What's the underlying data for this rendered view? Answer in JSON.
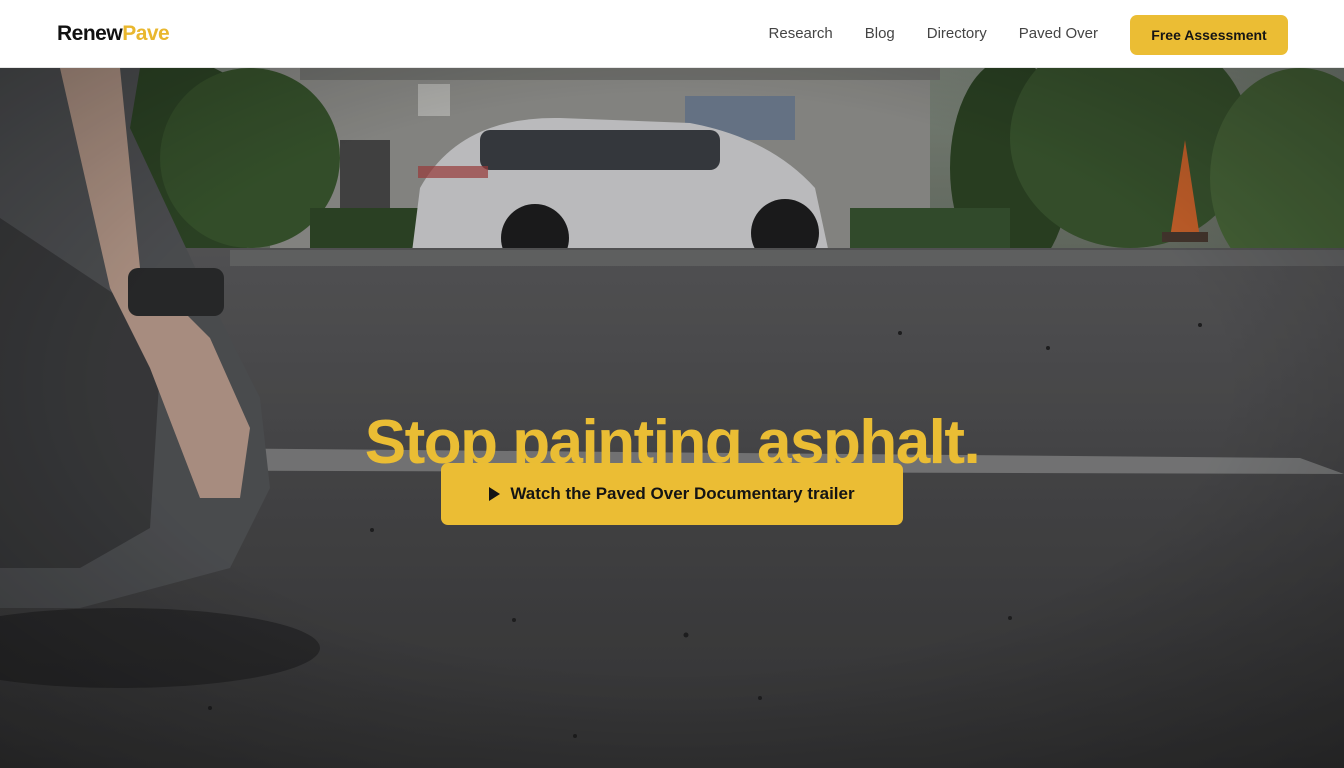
{
  "header": {
    "logo_part1": "Renew",
    "logo_part2": "Pave",
    "nav": {
      "research": "Research",
      "blog": "Blog",
      "directory": "Directory",
      "paved_over": "Paved Over"
    },
    "cta_label": "Free Assessment"
  },
  "hero": {
    "headline": "Stop painting asphalt.",
    "video_button_label": "Watch the Paved Over Documentary trailer",
    "video_button_icon": "play-icon"
  },
  "colors": {
    "accent": "#ebbd34",
    "header_bg": "#ffffff",
    "text_dark": "#111111",
    "nav_text": "#444444"
  }
}
